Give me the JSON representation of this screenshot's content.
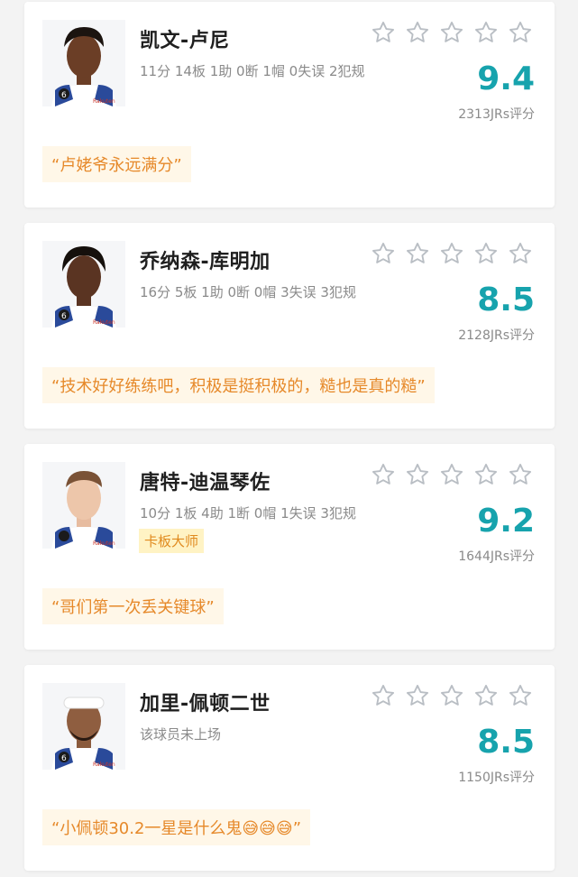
{
  "colors": {
    "accent": "#17a3ad",
    "comment_text": "#e6892a",
    "comment_bg": "#fff7e8",
    "tag_bg": "#fff3c4",
    "star_outline": "#b9bec4"
  },
  "players": [
    {
      "name": "凯文-卢尼",
      "stats": "11分 14板 1助 0断 1帽 0失误 2犯规",
      "tag": "",
      "score": "9.4",
      "ratings_count": "2313JRs评分",
      "comment": "“卢姥爷永远满分”",
      "stars_icon": "star-outline-icon"
    },
    {
      "name": "乔纳森-库明加",
      "stats": "16分 5板 1助 0断 0帽 3失误 3犯规",
      "tag": "",
      "score": "8.5",
      "ratings_count": "2128JRs评分",
      "comment": "“技术好好练练吧，积极是挺积极的，糙也是真的糙”",
      "stars_icon": "star-outline-icon"
    },
    {
      "name": "唐特-迪温琴佐",
      "stats": "10分 1板 4助 1断 0帽 1失误 3犯规",
      "tag": "卡板大师",
      "score": "9.2",
      "ratings_count": "1644JRs评分",
      "comment": "“哥们第一次丢关键球”",
      "stars_icon": "star-outline-icon"
    },
    {
      "name": "加里-佩顿二世",
      "stats": "该球员未上场",
      "tag": "",
      "score": "8.5",
      "ratings_count": "1150JRs评分",
      "comment": "“小佩顿30.2一星是什么鬼😅😅😅”",
      "stars_icon": "star-outline-icon"
    }
  ]
}
